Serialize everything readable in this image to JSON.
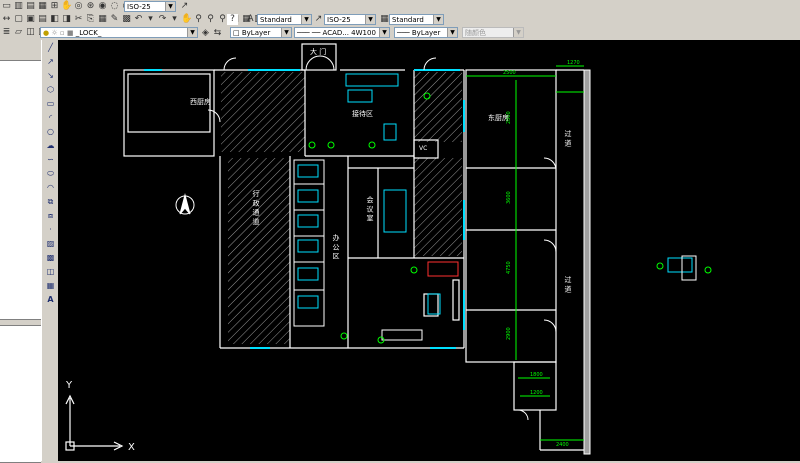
{
  "toolbar1": {
    "dimstyle_combo": "ISO-25",
    "textstyle_combo": "Standard",
    "dimstyle_combo2": "ISO-25",
    "tablestyle_combo": "Standard"
  },
  "toolbar2": {
    "layer_combo": "_LOCK_",
    "color_combo": "ByLayer",
    "linetype_combo": "ACAD... 4W100",
    "lineweight_combo": "ByLayer",
    "plotstyle_combo": "随颜色"
  },
  "drawing": {
    "door_main": "大 门",
    "room_west": "西厨房",
    "room_east": "东厨房",
    "area_lobby": "接待区",
    "area_office": "办 公 区",
    "room_meeting": "会 议 室",
    "corridor_side": "行 政 通 道",
    "vc_label": "VC",
    "corridor_right_1": "过 道",
    "corridor_right_2": "过 道",
    "dim_top_left": "2500",
    "dim_top_right": "1270",
    "dim_v1": "2800",
    "dim_v2": "3600",
    "dim_v3": "4750",
    "dim_v4": "2900",
    "dim_v5": "1800",
    "dim_bottom": "2400",
    "dim_b2": "1200",
    "ucs_y": "Y",
    "ucs_x": "X"
  },
  "colors": {
    "wall": "#ffffff",
    "dimension": "#00ff00",
    "furniture": "#00ffff",
    "hatch": "#a0a0a0",
    "plants": "#00ff00",
    "highlight": "#ff3030"
  }
}
